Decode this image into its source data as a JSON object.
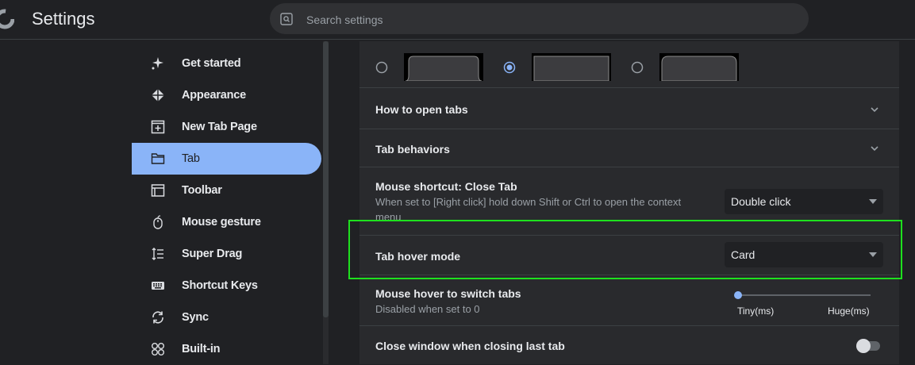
{
  "header": {
    "title": "Settings",
    "search_placeholder": "Search settings"
  },
  "sidebar": {
    "items": [
      {
        "label": "Get started",
        "icon": "sparkle-icon",
        "active": false
      },
      {
        "label": "Appearance",
        "icon": "appearance-icon",
        "active": false
      },
      {
        "label": "New Tab Page",
        "icon": "new-tab-page-icon",
        "active": false
      },
      {
        "label": "Tab",
        "icon": "folder-tab-icon",
        "active": true
      },
      {
        "label": "Toolbar",
        "icon": "toolbar-icon",
        "active": false
      },
      {
        "label": "Mouse gesture",
        "icon": "mouse-icon",
        "active": false
      },
      {
        "label": "Super Drag",
        "icon": "super-drag-icon",
        "active": false
      },
      {
        "label": "Shortcut Keys",
        "icon": "keyboard-icon",
        "active": false
      },
      {
        "label": "Sync",
        "icon": "sync-icon",
        "active": false
      },
      {
        "label": "Built-in",
        "icon": "grid-icon",
        "active": false
      }
    ]
  },
  "main": {
    "tab_style_options": [
      {
        "selected": false
      },
      {
        "selected": true
      },
      {
        "selected": false
      }
    ],
    "how_to_open_tabs": "How to open tabs",
    "tab_behaviors": "Tab behaviors",
    "mouse_shortcut": {
      "title": "Mouse shortcut: Close Tab",
      "description": "When set to [Right click] hold down Shift or Ctrl to open the context menu",
      "value": "Double click"
    },
    "tab_hover_mode": {
      "title": "Tab hover mode",
      "value": "Card"
    },
    "mouse_hover_switch": {
      "title": "Mouse hover to switch tabs",
      "description": "Disabled when set to 0",
      "min_label": "Tiny(ms)",
      "max_label": "Huge(ms)",
      "value": 0
    },
    "close_window_last_tab": {
      "title": "Close window when closing last tab",
      "enabled": false
    }
  },
  "colors": {
    "accent": "#8ab4f8",
    "highlight": "#1ee01e",
    "background": "#202124",
    "panel": "#292a2d"
  }
}
